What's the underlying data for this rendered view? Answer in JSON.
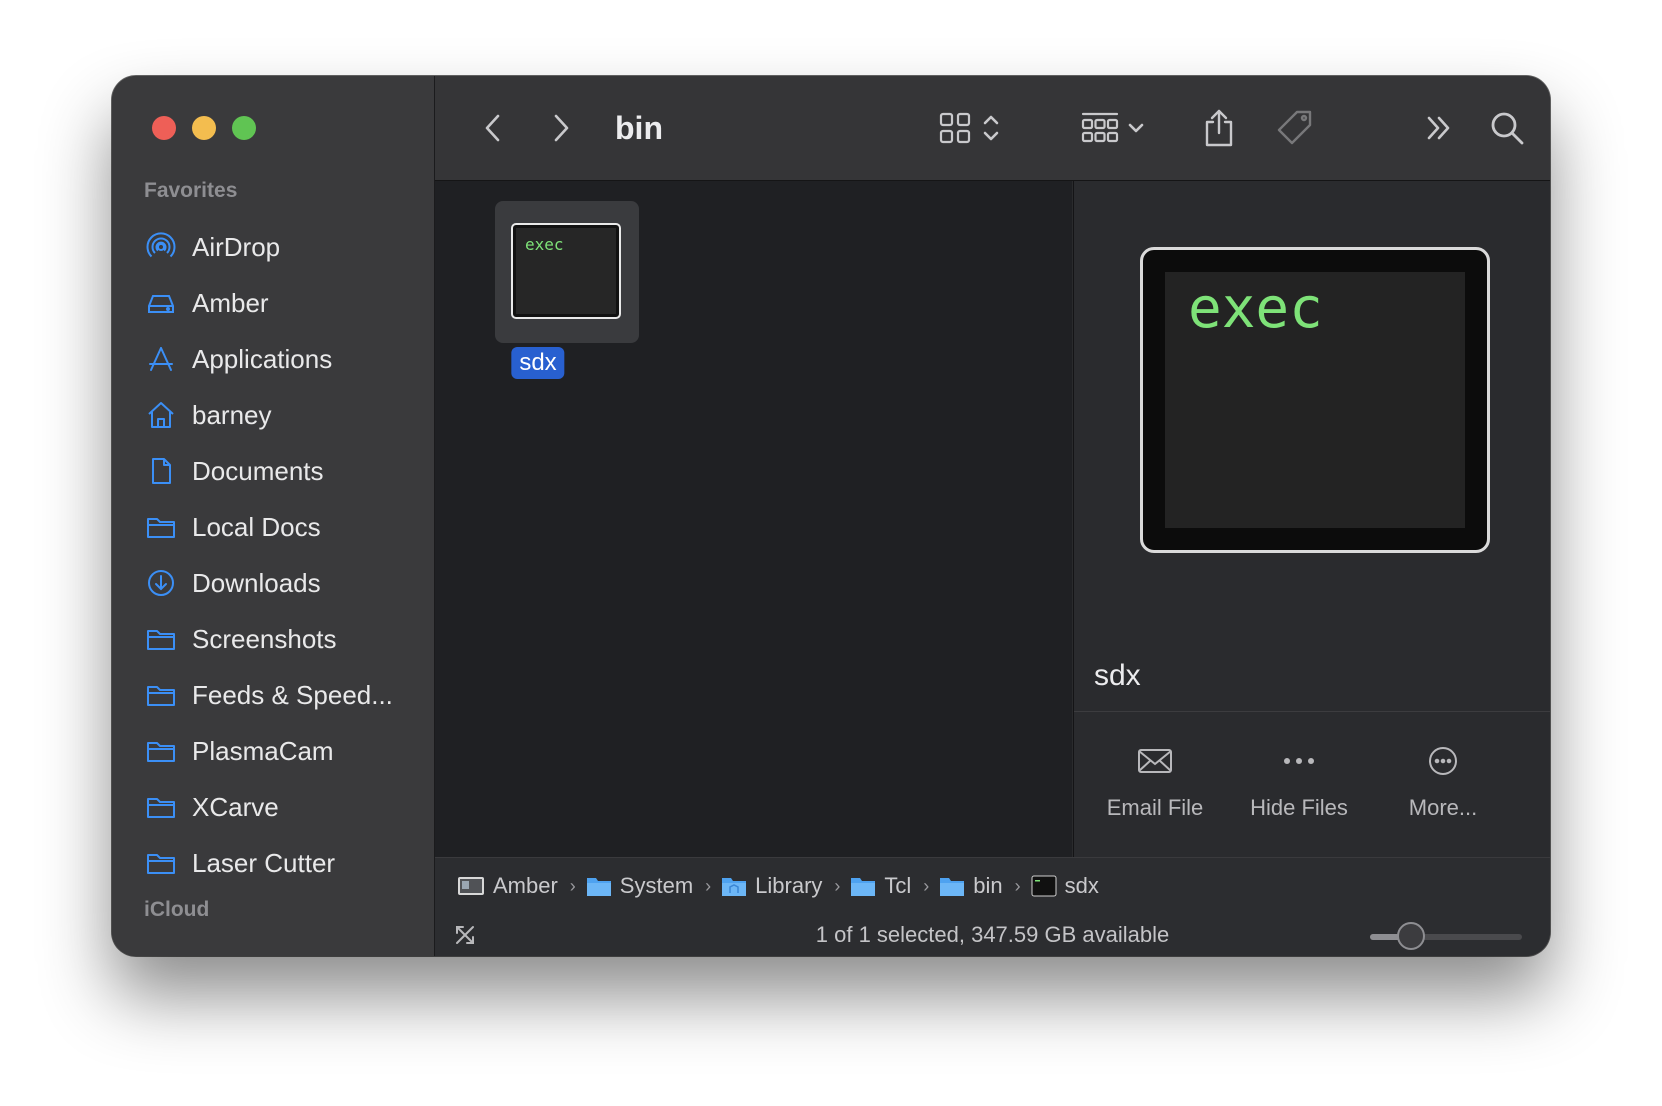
{
  "window": {
    "traffic_lights": [
      "close",
      "minimize",
      "zoom"
    ]
  },
  "sidebar": {
    "favorites_title": "Favorites",
    "items": [
      {
        "label": "AirDrop",
        "icon": "airdrop-icon"
      },
      {
        "label": "Amber",
        "icon": "drive-icon"
      },
      {
        "label": "Applications",
        "icon": "applications-icon"
      },
      {
        "label": "barney",
        "icon": "home-icon"
      },
      {
        "label": "Documents",
        "icon": "document-icon"
      },
      {
        "label": "Local Docs",
        "icon": "folder-icon"
      },
      {
        "label": "Downloads",
        "icon": "downloads-icon"
      },
      {
        "label": "Screenshots",
        "icon": "folder-icon"
      },
      {
        "label": "Feeds & Speed...",
        "icon": "folder-icon"
      },
      {
        "label": "PlasmaCam",
        "icon": "folder-icon"
      },
      {
        "label": "XCarve",
        "icon": "folder-icon"
      },
      {
        "label": "Laser Cutter",
        "icon": "folder-icon"
      }
    ],
    "icloud_title": "iCloud"
  },
  "toolbar": {
    "title": "bin"
  },
  "content": {
    "file": {
      "name": "sdx",
      "icon_text": "exec",
      "selected": true
    }
  },
  "preview": {
    "icon_text": "exec",
    "name": "sdx",
    "actions": [
      {
        "label": "Email File",
        "icon": "envelope-icon"
      },
      {
        "label": "Hide Files",
        "icon": "ellipsis-icon"
      },
      {
        "label": "More...",
        "icon": "more-circle-icon"
      }
    ]
  },
  "pathbar": {
    "crumbs": [
      "Amber",
      "System",
      "Library",
      "Tcl",
      "bin",
      "sdx"
    ]
  },
  "statusbar": {
    "text": "1 of 1 selected, 347.59 GB available",
    "icon_size_level": 0.27
  },
  "colors": {
    "accent": "#2860d0",
    "sidebar_icon": "#3b8ff6",
    "terminal_text": "#7ee278"
  }
}
